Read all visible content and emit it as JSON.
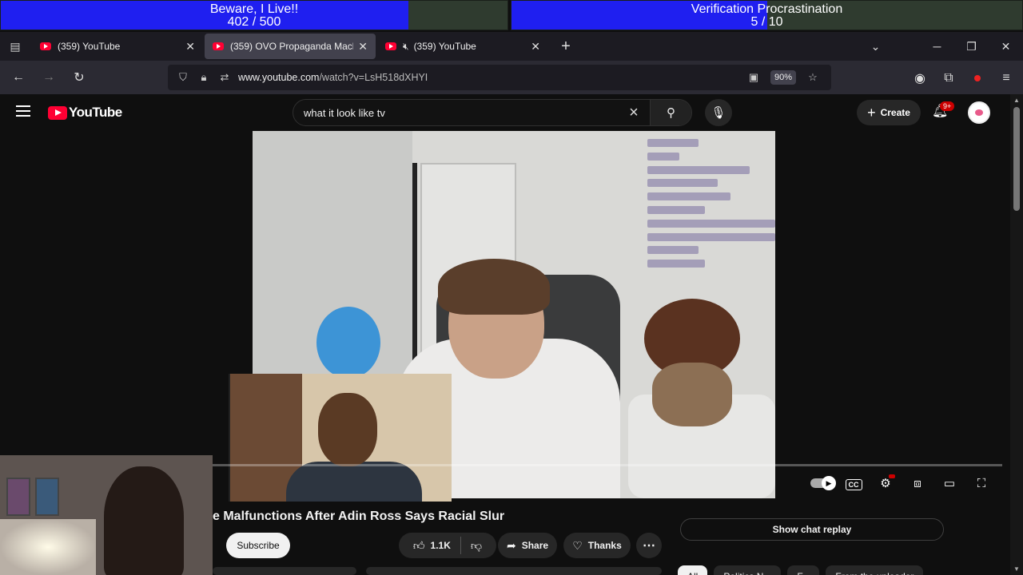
{
  "overlay": {
    "goal1": {
      "title": "Beware, I Live!!",
      "progress_text": "402 / 500",
      "fraction": 0.804
    },
    "goal2": {
      "title": "Verification Procrastination",
      "progress_text": "5 / 10",
      "fraction": 0.5
    }
  },
  "tabs": [
    {
      "label": "(359) YouTube",
      "active": false,
      "muted": false
    },
    {
      "label": "(359) OVO Propaganda Machine",
      "active": true,
      "muted": false
    },
    {
      "label": "(359) YouTube",
      "active": false,
      "muted": true
    }
  ],
  "nav": {
    "url_host": "www.youtube.com",
    "url_path": "/watch?v=LsH518dXHYI",
    "zoom": "90%"
  },
  "youtube": {
    "logo_text": "YouTube",
    "search_query": "what it look like tv",
    "create_label": "Create",
    "notifications_badge": "9+"
  },
  "video": {
    "title_visible": "e Malfunctions After Adin Ross Says Racial Slur",
    "subscribe_label": "Subscribe",
    "likes": "1.1K",
    "share_label": "Share",
    "thanks_label": "Thanks",
    "chat_replay_label": "Show chat replay",
    "cc_label": "CC",
    "chips": [
      "All",
      "Politics N...",
      "F...",
      "From the uploader"
    ]
  },
  "icons": {
    "back": "arrow-left-icon",
    "forward": "arrow-right-icon",
    "reload": "reload-icon",
    "settings": "gear-icon"
  }
}
